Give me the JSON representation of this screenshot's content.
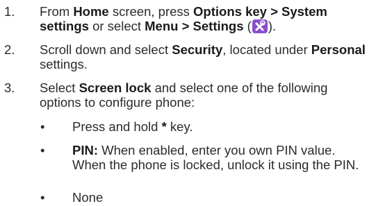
{
  "steps": [
    {
      "num": "1.",
      "parts": [
        "From ",
        "Home",
        " screen, press ",
        "Options key > System settings",
        " or select ",
        "Menu > Settings",
        " (",
        ")."
      ],
      "icon": "settings-tools-icon"
    },
    {
      "num": "2.",
      "parts": [
        "Scroll down and select ",
        "Security",
        ", located under ",
        "Personal",
        " settings."
      ]
    },
    {
      "num": "3.",
      "parts": [
        "Select ",
        "Screen lock",
        " and select one of the following options to configure phone:"
      ]
    }
  ],
  "bullets": [
    {
      "marker": "•",
      "parts": [
        "Press and hold ",
        "*",
        " key."
      ]
    },
    {
      "marker": "•",
      "parts": [
        "PIN:",
        " When enabled, enter you own PIN value. When the phone is locked, unlock it using the PIN."
      ]
    },
    {
      "marker": "•",
      "parts": [
        "None"
      ]
    }
  ],
  "colors": {
    "icon_bg": "#8a4fcf",
    "text": "#2b2b2b"
  }
}
